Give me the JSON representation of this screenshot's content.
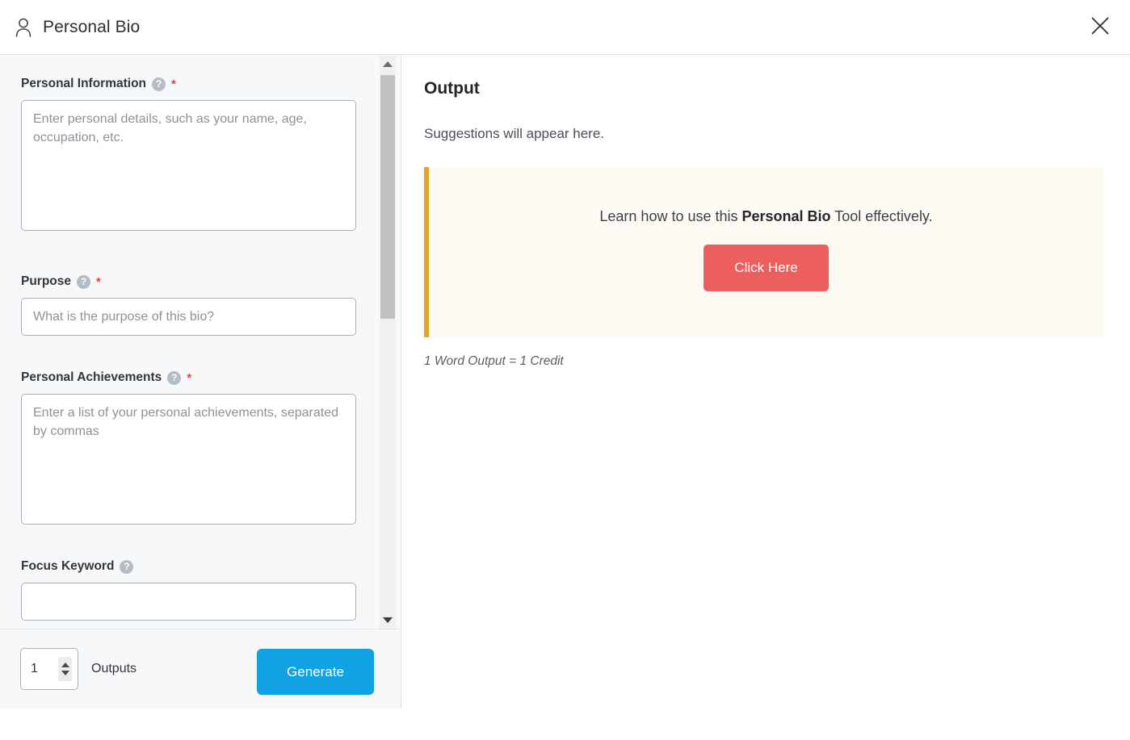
{
  "header": {
    "icon": "person-icon",
    "title": "Personal Bio",
    "close_icon": "close-icon"
  },
  "form": {
    "help_glyph": "?",
    "required_glyph": "*",
    "fields": [
      {
        "label": "Personal Information",
        "required": true,
        "type": "textarea",
        "value": "",
        "placeholder": "Enter personal details, such as your name, age, occupation, etc."
      },
      {
        "label": "Purpose",
        "required": true,
        "type": "text",
        "value": "",
        "placeholder": "What is the purpose of this bio?"
      },
      {
        "label": "Personal Achievements",
        "required": true,
        "type": "textarea",
        "value": "",
        "placeholder": "Enter a list of your personal achievements, separated by commas"
      },
      {
        "label": "Focus Keyword",
        "required": false,
        "type": "text",
        "value": "",
        "placeholder": ""
      }
    ]
  },
  "footer": {
    "outputs_value": "1",
    "outputs_label": "Outputs",
    "generate_label": "Generate",
    "generate_color": "#10a2e3"
  },
  "output": {
    "title": "Output",
    "subtitle": "Suggestions will appear here.",
    "alert": {
      "text_before": "Learn how to use this ",
      "text_bold": "Personal Bio",
      "text_after": " Tool effectively.",
      "button_label": "Click Here",
      "button_color": "#ec5f5f",
      "accent_color": "#e0a526",
      "background_color": "#fdfaf4"
    },
    "credit_note": "1 Word Output = 1 Credit"
  }
}
